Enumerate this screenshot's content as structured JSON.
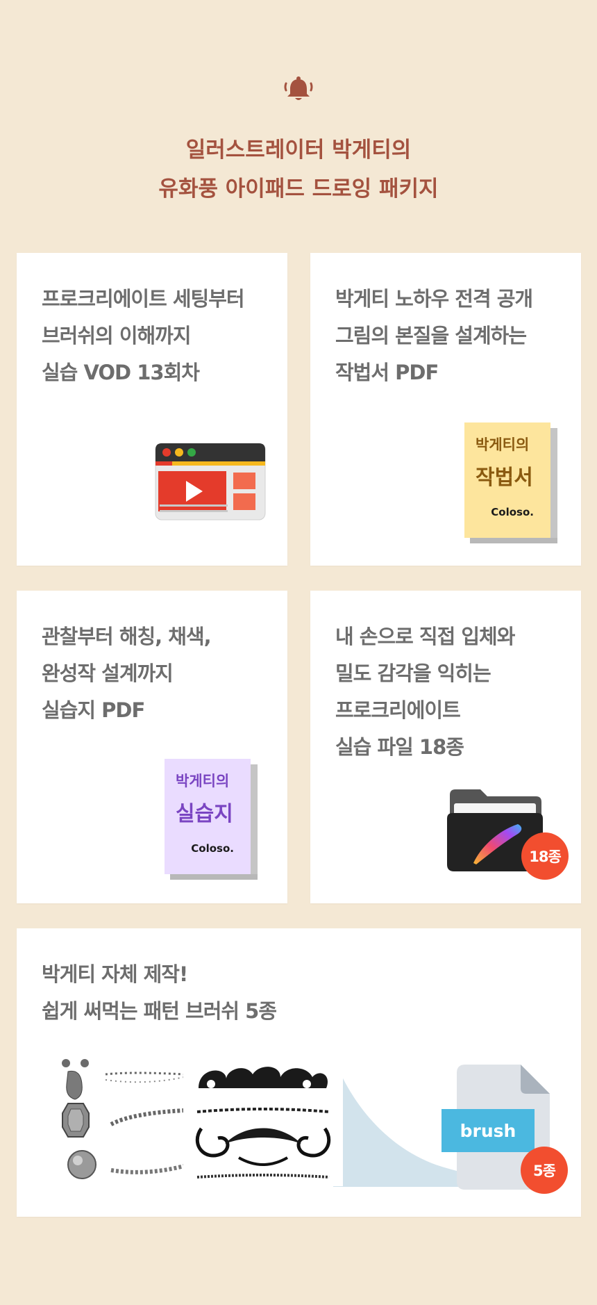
{
  "header": {
    "title_line1": "일러스트레이터 박게티의",
    "title_line2": "유화풍 아이패드 드로잉 패키지",
    "icon": "bell-icon"
  },
  "cards": [
    {
      "lines": [
        "프로크리에이트 세팅부터",
        "브러쉬의 이해까지",
        "실습 VOD 13회차"
      ],
      "icon": "video-player-icon"
    },
    {
      "lines": [
        "박게티 노하우 전격 공개",
        "그림의 본질을 설계하는",
        "작법서 PDF"
      ],
      "book": {
        "sub": "박게티의",
        "main": "작법서",
        "logo": "Coloso."
      }
    },
    {
      "lines": [
        "관찰부터 해칭, 채색,",
        "완성작 설계까지",
        "실습지 PDF"
      ],
      "book": {
        "sub": "박게티의",
        "main": "실습지",
        "logo": "Coloso."
      }
    },
    {
      "lines": [
        "내 손으로 직접 입체와",
        "밀도 감각을 익히는",
        "프로크리에이트",
        "실습 파일 18종"
      ],
      "icon": "procreate-folder-icon",
      "badge": "18종"
    },
    {
      "lines": [
        "박게티 자체 제작!",
        "쉽게 써먹는 패턴 브러쉬 5종"
      ],
      "file_label": "brush",
      "badge": "5종"
    }
  ],
  "colors": {
    "background": "#f4e8d4",
    "heading": "#a4523f",
    "card_text": "#6d6d6d",
    "badge": "#f24e2f",
    "book_yellow": "#fde59d",
    "book_purple": "#eadcff",
    "brush_label": "#4bb8e0"
  }
}
